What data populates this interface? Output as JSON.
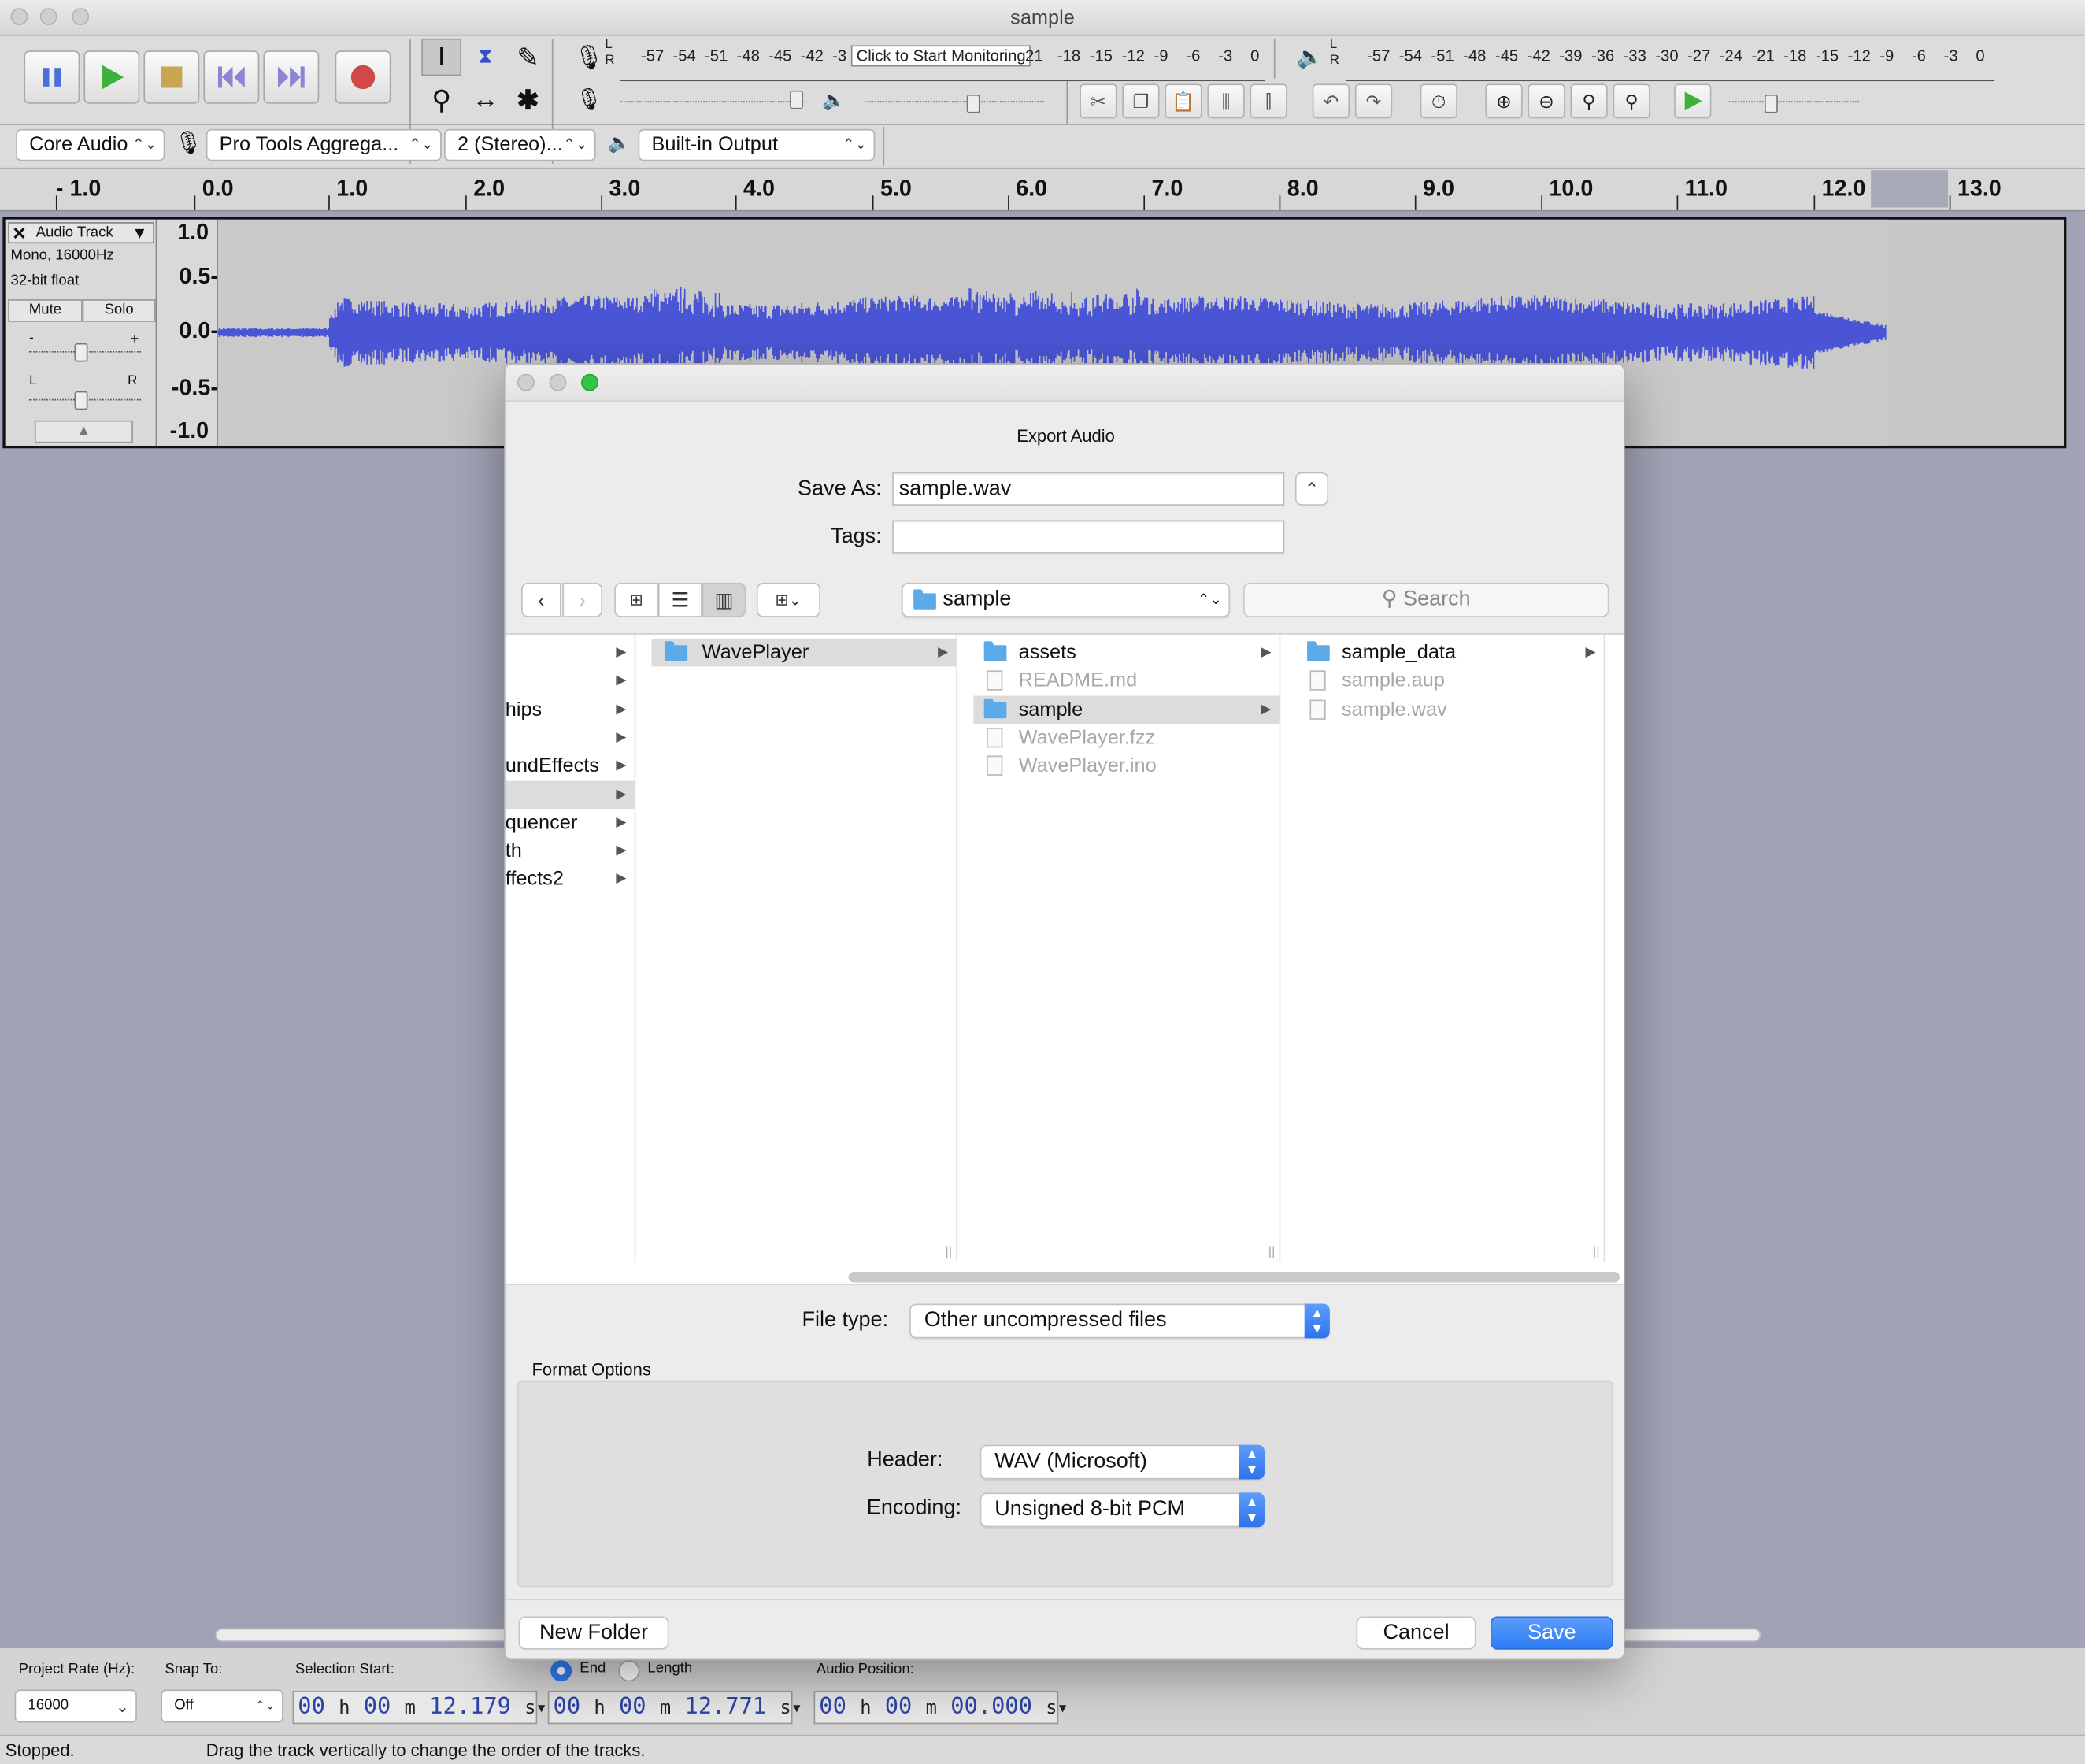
{
  "window": {
    "title": "sample"
  },
  "meters": {
    "record_scale": [
      "-57",
      "-54",
      "-51",
      "-48",
      "-45",
      "-42",
      "-3́"
    ],
    "record_scale_tail": [
      "21",
      "-18",
      "-15",
      "-12",
      "-9",
      "-6",
      "-3",
      "0"
    ],
    "monitor_tooltip": "Click to Start Monitoring",
    "playback_scale": [
      "-57",
      "-54",
      "-51",
      "-48",
      "-45",
      "-42",
      "-39",
      "-36",
      "-33",
      "-30",
      "-27",
      "-24",
      "-21",
      "-18",
      "-15",
      "-12",
      "-9",
      "-6",
      "-3",
      "0"
    ],
    "lr_l": "L",
    "lr_r": "R"
  },
  "devices": {
    "host": "Core Audio",
    "input": "Pro Tools Aggrega...",
    "channels": "2 (Stereo)...",
    "output": "Built-in Output"
  },
  "ruler": {
    "labels": [
      "- 1.0",
      "0.0",
      "1.0",
      "2.0",
      "3.0",
      "4.0",
      "5.0",
      "6.0",
      "7.0",
      "8.0",
      "9.0",
      "10.0",
      "11.0",
      "12.0",
      "13.0"
    ]
  },
  "track": {
    "name": "Audio Track",
    "info1": "Mono, 16000Hz",
    "info2": "32-bit float",
    "mute": "Mute",
    "solo": "Solo",
    "pan_l": "L",
    "pan_r": "R",
    "scale": [
      "1.0",
      "0.5-",
      "0.0-",
      "-0.5-",
      "-1.0"
    ]
  },
  "dialog": {
    "title": "Export Audio",
    "save_as_label": "Save As:",
    "save_as_value": "sample.wav",
    "tags_label": "Tags:",
    "tags_value": "",
    "location": "sample",
    "search_placeholder": "Search",
    "col1": [
      "",
      "",
      "hips",
      "",
      "undEffects",
      "",
      "quencer",
      "th",
      "ffects2"
    ],
    "col2": [
      "WavePlayer"
    ],
    "col3": [
      "assets",
      "README.md",
      "sample",
      "WavePlayer.fzz",
      "WavePlayer.ino"
    ],
    "col4": [
      "sample_data",
      "sample.aup",
      "sample.wav"
    ],
    "file_type_label": "File type:",
    "file_type_value": "Other uncompressed files",
    "format_options_label": "Format Options",
    "header_label": "Header:",
    "header_value": "WAV (Microsoft)",
    "encoding_label": "Encoding:",
    "encoding_value": "Unsigned 8-bit PCM",
    "new_folder": "New Folder",
    "cancel": "Cancel",
    "save": "Save",
    "accent": "#2f7cf6"
  },
  "bottom": {
    "project_rate_label": "Project Rate (Hz):",
    "project_rate_value": "16000",
    "snap_label": "Snap To:",
    "snap_value": "Off",
    "sel_start_label": "Selection Start:",
    "end_label": "End",
    "length_label": "Length",
    "audio_pos_label": "Audio Position:",
    "sel_start": {
      "h": "00",
      "m": "00",
      "s": "12.179"
    },
    "sel_end": {
      "h": "00",
      "m": "00",
      "s": "12.771"
    },
    "audio_pos": {
      "h": "00",
      "m": "00",
      "s": "00.000"
    },
    "unit_h": "h",
    "unit_m": "m",
    "unit_s": "s"
  },
  "status": {
    "left": "Stopped.",
    "right": "Drag the track vertically to change the order of the tracks."
  },
  "colors": {
    "wave": "#4a55d6",
    "background": "#a0a3b5"
  }
}
